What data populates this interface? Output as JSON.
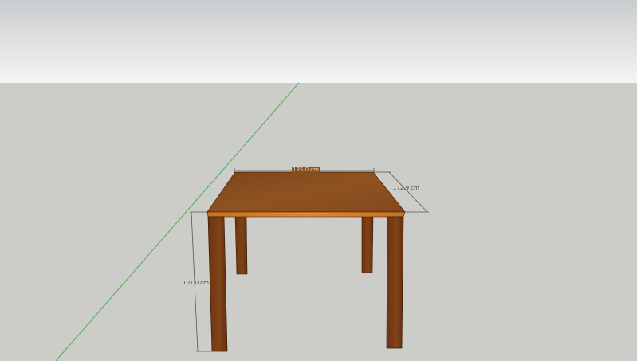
{
  "dimensions": {
    "width_label": "135.0 cm",
    "depth_label": "172.9 cm",
    "height_label": "101.0 cm"
  },
  "colors": {
    "sky_top": "#c9ccce",
    "sky_bottom": "#f2f3f3",
    "ground": "#ccccc8",
    "axis_green": "#4caf50",
    "tabletop": "#8a4e1e",
    "tabletop_edge": "#d07a2a",
    "leg": "#7a3f14",
    "leg_dark": "#5a2c0c",
    "dimension_line": "#555555"
  }
}
